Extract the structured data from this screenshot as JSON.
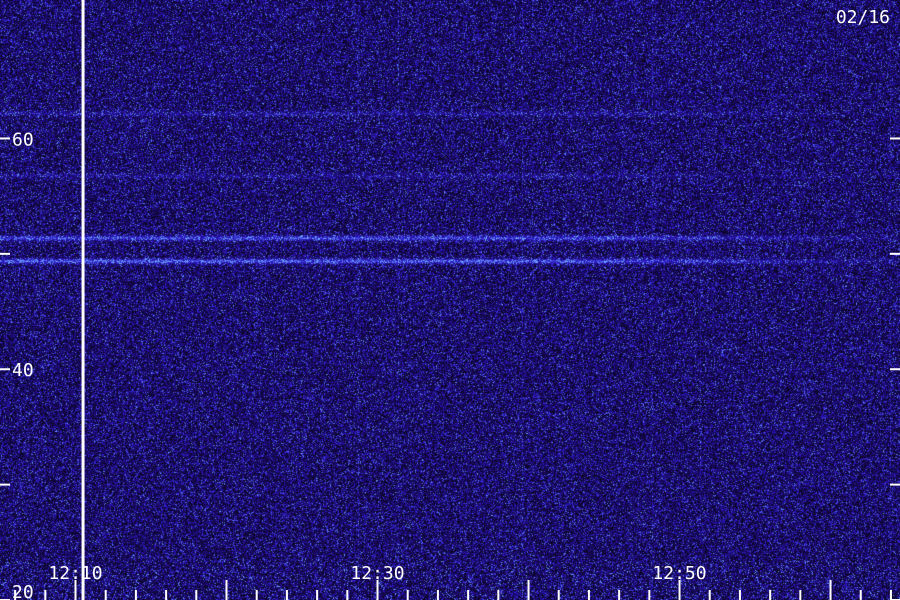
{
  "chart_data": {
    "type": "heatmap",
    "date_label": "02/16",
    "x_tick_labels": [
      "12:10",
      "12:30",
      "12:50"
    ],
    "x_tick_minutes": [
      10,
      30,
      50
    ],
    "x_range_minutes": [
      5,
      64.6
    ],
    "y_tick_labels": [
      "20",
      "40",
      "60"
    ],
    "y_tick_values": [
      20,
      40,
      60
    ],
    "y_minor_ticks": [
      30,
      50
    ],
    "y_range": [
      20,
      72
    ],
    "marker_minute": 10.5,
    "bands": [
      {
        "y": 51.4,
        "strength": 0.9
      },
      {
        "y": 49.4,
        "strength": 1.0
      },
      {
        "y": 62.2,
        "strength": 0.35
      },
      {
        "y": 56.8,
        "strength": 0.3
      }
    ],
    "colors": {
      "background": "#0b0520",
      "low": "#2a0a6e",
      "mid": "#3a22e0",
      "high": "#7ab6ff",
      "label": "#ffffff"
    }
  }
}
